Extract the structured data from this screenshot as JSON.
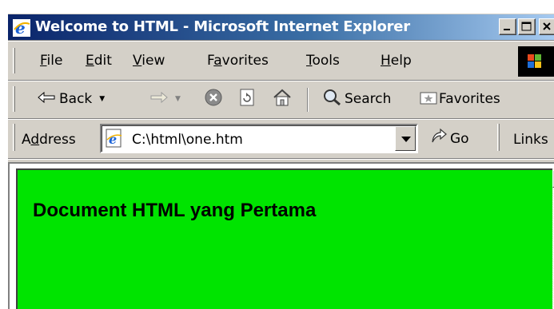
{
  "window": {
    "title": "Welcome to HTML - Microsoft Internet Explorer"
  },
  "menu": {
    "items": [
      {
        "label": "File",
        "accel": "F",
        "rest": "ile"
      },
      {
        "label": "Edit",
        "accel": "E",
        "rest": "dit"
      },
      {
        "label": "View",
        "accel": "V",
        "rest": "iew"
      },
      {
        "label": "Favorites",
        "pre": "F",
        "accel": "a",
        "rest": "vorites"
      },
      {
        "label": "Tools",
        "accel": "T",
        "rest": "ools"
      },
      {
        "label": "Help",
        "accel": "H",
        "rest": "elp"
      }
    ]
  },
  "toolbar": {
    "back_label": "Back",
    "search_label": "Search",
    "favorites_label": "Favorites"
  },
  "address_bar": {
    "label_pre": "A",
    "label_accel": "d",
    "label_rest": "dress",
    "value": "C:\\html\\one.htm",
    "go_label": "Go",
    "links_label": "Links"
  },
  "page": {
    "heading": "Document HTML yang Pertama",
    "background_color": "#00e400"
  },
  "icons": {
    "title": "ie-icon",
    "back": "back-arrow-icon",
    "forward": "forward-arrow-icon",
    "stop": "stop-icon",
    "refresh": "refresh-icon",
    "home": "home-icon",
    "search": "search-icon",
    "favorites": "favorites-icon",
    "go": "go-arrow-icon"
  }
}
